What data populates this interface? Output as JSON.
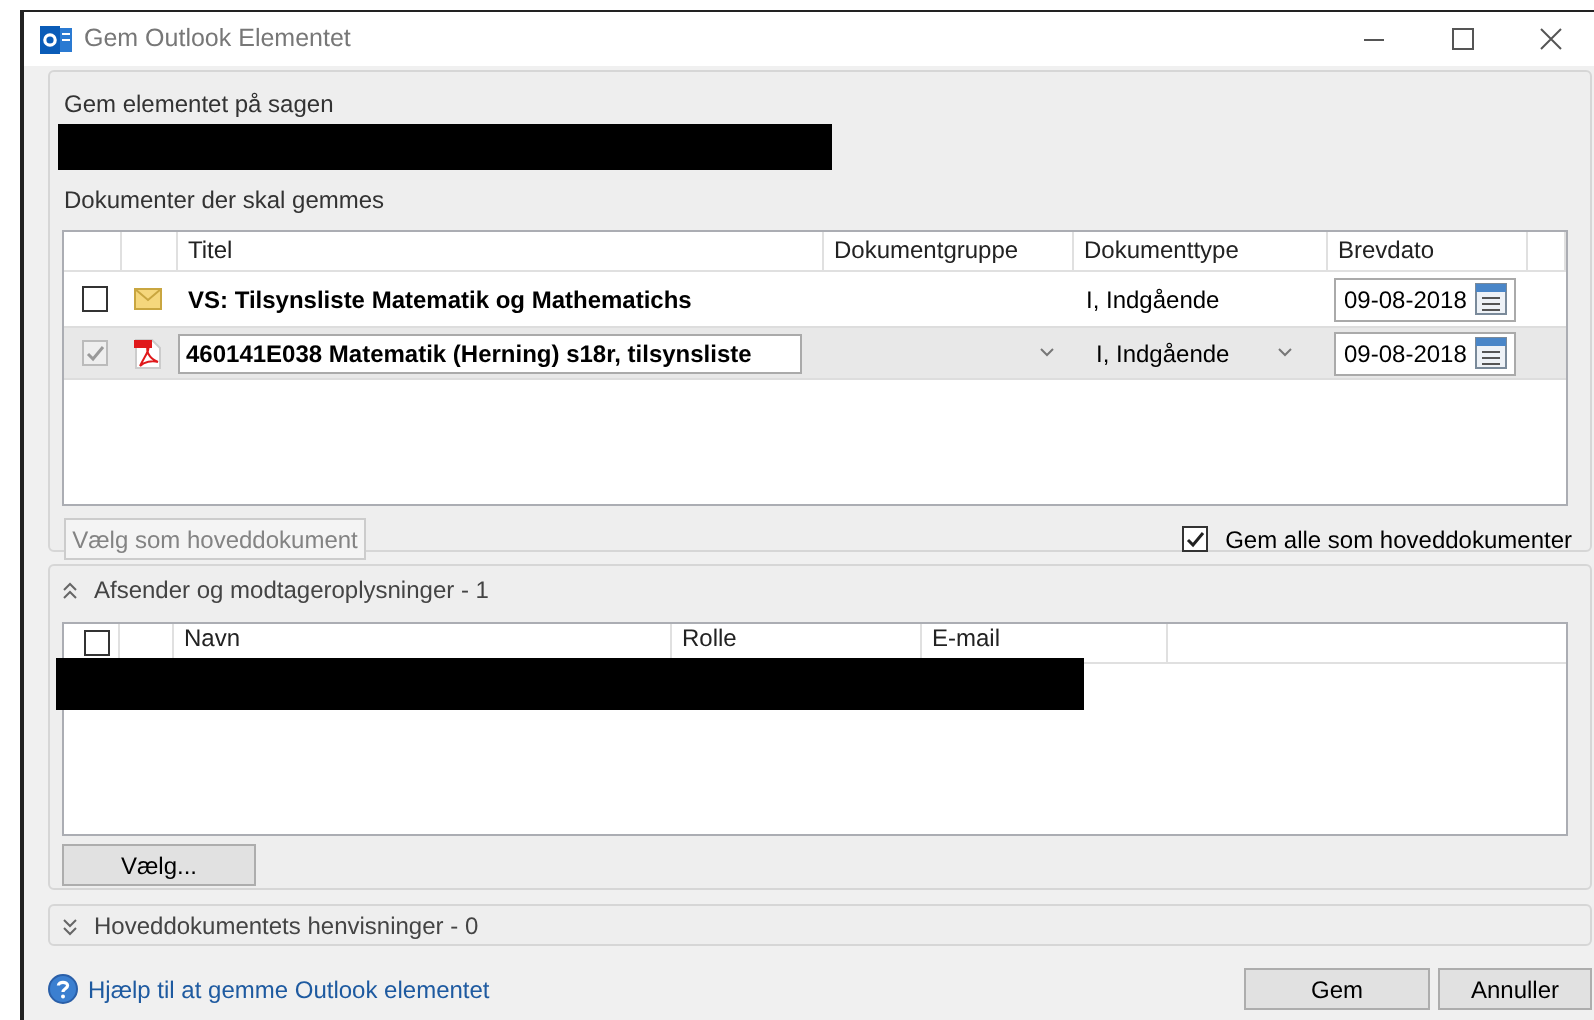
{
  "window": {
    "title": "Gem Outlook Elementet"
  },
  "case": {
    "label": "Gem elementet på sagen",
    "redacted": true
  },
  "documents": {
    "label": "Dokumenter der skal gemmes",
    "columns": [
      "Titel",
      "Dokumentgruppe",
      "Dokumenttype",
      "Brevdato"
    ],
    "rows": [
      {
        "checked": false,
        "disabled": false,
        "kind": "email",
        "title": "VS: Tilsynsliste  Matematik og Mathematichs",
        "editing": false,
        "type": "I, Indgående",
        "date": "09-08-2018",
        "selected": false
      },
      {
        "checked": true,
        "disabled": true,
        "kind": "pdf",
        "title": "460141E038 Matematik (Herning) s18r, tilsynsliste",
        "editing": true,
        "type": "I, Indgående",
        "date": "09-08-2018",
        "selected": true
      }
    ],
    "main_button": {
      "label": "Vælg som hoveddokument",
      "disabled": true
    },
    "save_all": {
      "label": "Gem alle som hoveddokumenter",
      "checked": true
    }
  },
  "recipients": {
    "header": "Afsender og modtageroplysninger - 1",
    "expanded": true,
    "columns": [
      "Navn",
      "Rolle",
      "E-mail"
    ],
    "select_all_checked": false,
    "row_redacted": true,
    "button": "Vælg..."
  },
  "references": {
    "header": "Hoveddokumentets henvisninger - 0",
    "expanded": false
  },
  "help_link": "Hjælp til at gemme Outlook elementet",
  "buttons": [
    "Gem",
    "Annuller"
  ]
}
